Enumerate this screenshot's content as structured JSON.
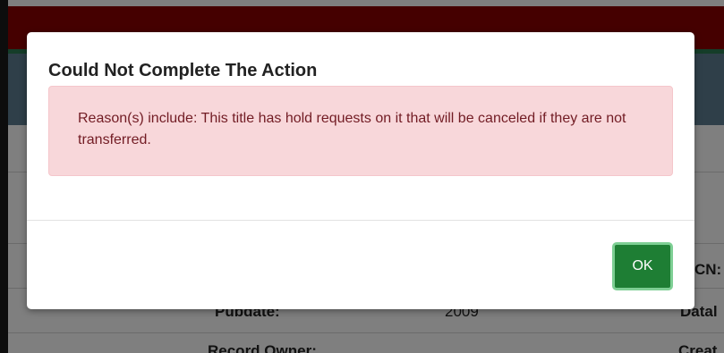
{
  "background": {
    "pubdate_label": "Pubdate:",
    "pubdate_value": "2009",
    "record_owner_label": "Record Owner:",
    "right_partial_1": "CN:",
    "right_partial_2": "Datal",
    "right_partial_3": "Creat"
  },
  "modal": {
    "title": "Could Not Complete The Action",
    "message": "Reason(s) include: This title has hold requests on it that will be canceled if they are not transferred.",
    "ok_label": "OK"
  },
  "colors": {
    "header": "#8b0000",
    "alert_bg": "#f8d7da",
    "alert_text": "#721c24",
    "ok_button": "#1e7e34"
  }
}
